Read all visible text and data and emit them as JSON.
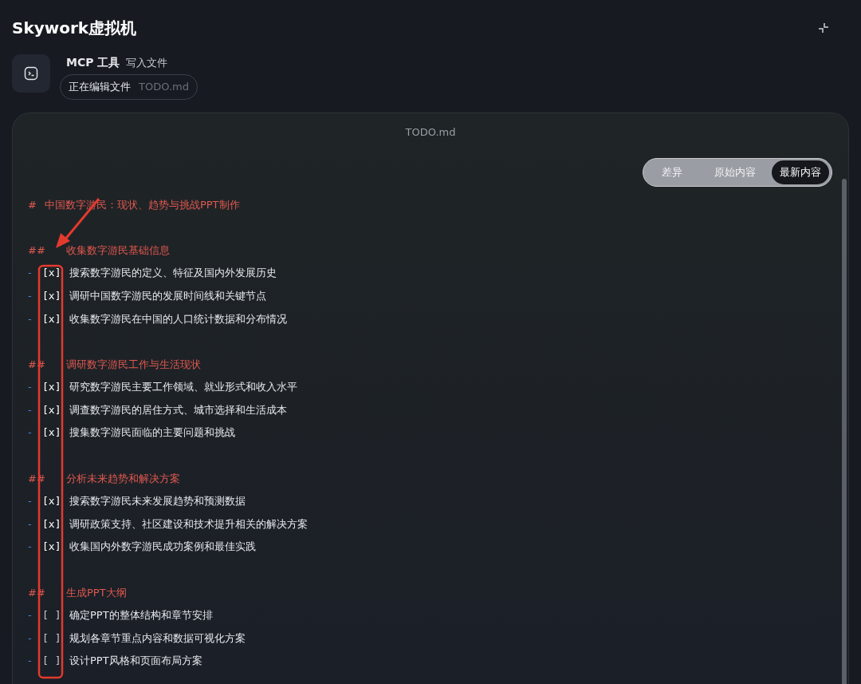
{
  "window": {
    "title": "Skywork虚拟机"
  },
  "tool": {
    "name": "MCP 工具",
    "action": "写入文件",
    "status": "正在编辑文件",
    "file": "TODO.md"
  },
  "editor": {
    "title": "TODO.md",
    "view_tabs": [
      {
        "label": "差异",
        "selected": false
      },
      {
        "label": "原始内容",
        "selected": false
      },
      {
        "label": "最新内容",
        "selected": true
      }
    ],
    "heading": {
      "prefix": "#",
      "text": "中国数字游民：现状、趋势与挑战PPT制作"
    },
    "sections": [
      {
        "prefix": "##",
        "heading": "收集数字游民基础信息",
        "tasks": [
          {
            "bullet": "-",
            "marker": "[x]",
            "checked": true,
            "text": "搜索数字游民的定义、特征及国内外发展历史"
          },
          {
            "bullet": "-",
            "marker": "[x]",
            "checked": true,
            "text": "调研中国数字游民的发展时间线和关键节点"
          },
          {
            "bullet": "-",
            "marker": "[x]",
            "checked": true,
            "text": "收集数字游民在中国的人口统计数据和分布情况"
          }
        ]
      },
      {
        "prefix": "##",
        "heading": "调研数字游民工作与生活现状",
        "tasks": [
          {
            "bullet": "-",
            "marker": "[x]",
            "checked": true,
            "text": "研究数字游民主要工作领域、就业形式和收入水平"
          },
          {
            "bullet": "-",
            "marker": "[x]",
            "checked": true,
            "text": "调查数字游民的居住方式、城市选择和生活成本"
          },
          {
            "bullet": "-",
            "marker": "[x]",
            "checked": true,
            "text": "搜集数字游民面临的主要问题和挑战"
          }
        ]
      },
      {
        "prefix": "##",
        "heading": "分析未来趋势和解决方案",
        "tasks": [
          {
            "bullet": "-",
            "marker": "[x]",
            "checked": true,
            "text": "搜索数字游民未来发展趋势和预测数据"
          },
          {
            "bullet": "-",
            "marker": "[x]",
            "checked": true,
            "text": "调研政策支持、社区建设和技术提升相关的解决方案"
          },
          {
            "bullet": "-",
            "marker": "[x]",
            "checked": true,
            "text": "收集国内外数字游民成功案例和最佳实践"
          }
        ]
      },
      {
        "prefix": "##",
        "heading": "生成PPT大纲",
        "tasks": [
          {
            "bullet": "-",
            "marker": "[ ]",
            "checked": false,
            "text": "确定PPT的整体结构和章节安排"
          },
          {
            "bullet": "-",
            "marker": "[ ]",
            "checked": false,
            "text": "规划各章节重点内容和数据可视化方案"
          },
          {
            "bullet": "-",
            "marker": "[ ]",
            "checked": false,
            "text": "设计PPT风格和页面布局方案"
          }
        ]
      }
    ]
  }
}
